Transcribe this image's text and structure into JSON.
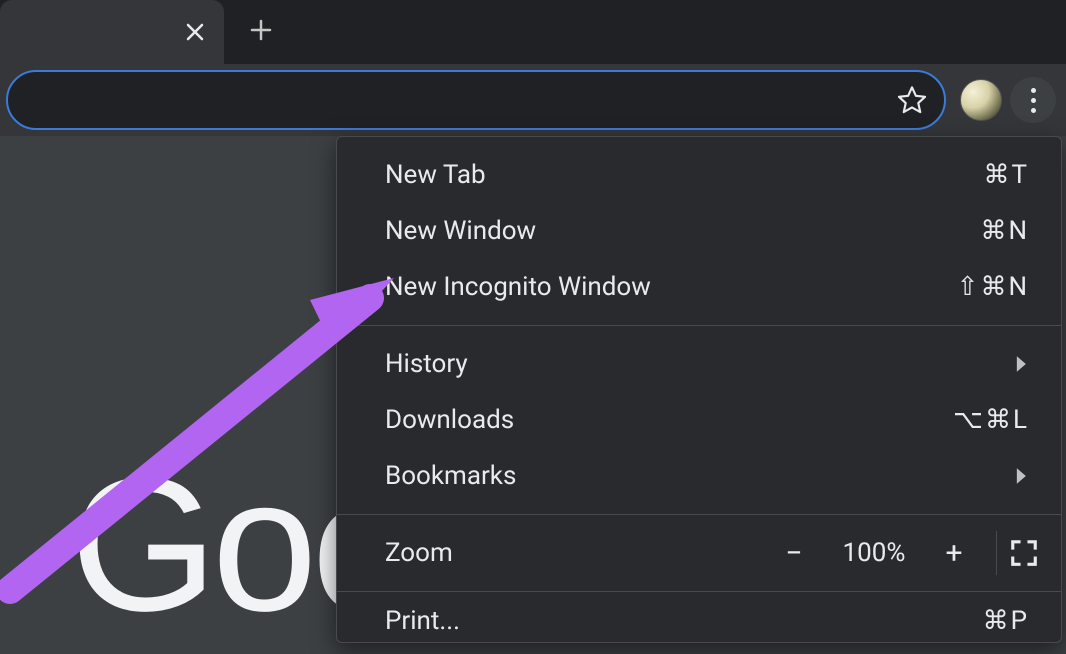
{
  "tabstrip": {
    "close_icon": "close-x",
    "new_tab_icon": "plus"
  },
  "toolbar": {
    "bookmark_icon": "star-outline",
    "avatar": "user-avatar",
    "menu_icon": "kebab-vertical"
  },
  "page": {
    "logo_fragment": "Goc"
  },
  "menu": {
    "items_top": [
      {
        "label": "New Tab",
        "shortcut": "⌘T",
        "name": "menu-new-tab"
      },
      {
        "label": "New Window",
        "shortcut": "⌘N",
        "name": "menu-new-window"
      },
      {
        "label": "New Incognito Window",
        "shortcut": "⇧⌘N",
        "name": "menu-new-incognito"
      }
    ],
    "items_mid": [
      {
        "label": "History",
        "submenu": true,
        "name": "menu-history"
      },
      {
        "label": "Downloads",
        "shortcut": "⌥⌘L",
        "name": "menu-downloads"
      },
      {
        "label": "Bookmarks",
        "submenu": true,
        "name": "menu-bookmarks"
      }
    ],
    "zoom": {
      "label": "Zoom",
      "minus": "−",
      "value": "100%",
      "plus": "+",
      "fullscreen_icon": "fullscreen"
    },
    "items_bottom": [
      {
        "label": "Print...",
        "shortcut": "⌘P",
        "name": "menu-print"
      }
    ]
  },
  "annotation": {
    "arrow_color": "#b265f0"
  }
}
